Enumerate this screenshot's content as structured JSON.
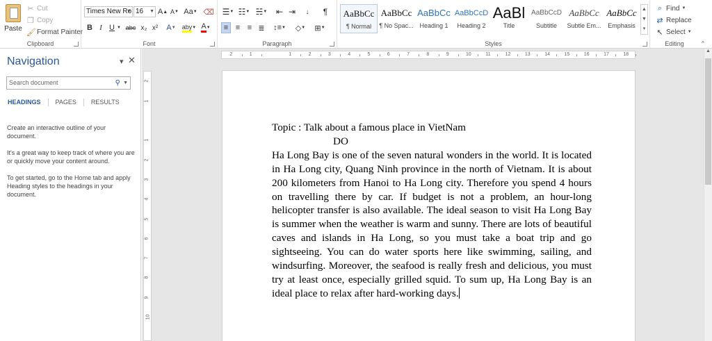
{
  "ribbon": {
    "clipboard": {
      "label": "Clipboard",
      "paste": "Paste",
      "cut": "Cut",
      "copy": "Copy",
      "format_painter": "Format Painter"
    },
    "font": {
      "label": "Font",
      "font_name": "Times New Ro",
      "font_size": "16",
      "grow": "A",
      "shrink": "A",
      "case": "Aa",
      "bold": "B",
      "italic": "I",
      "underline": "U",
      "strike": "abc",
      "subscript": "x₂",
      "superscript": "x²",
      "effects": "A",
      "highlight": "aby",
      "color": "A"
    },
    "paragraph": {
      "label": "Paragraph",
      "pilcrow": "¶"
    },
    "styles": {
      "label": "Styles",
      "items": [
        {
          "preview": "AaBbCc",
          "name": "¶ Normal"
        },
        {
          "preview": "AaBbCc",
          "name": "¶ No Spac..."
        },
        {
          "preview": "AaBbCc",
          "name": "Heading 1"
        },
        {
          "preview": "AaBbCcD",
          "name": "Heading 2"
        },
        {
          "preview": "AaBl",
          "name": "Title"
        },
        {
          "preview": "AaBbCcD",
          "name": "Subtitle"
        },
        {
          "preview": "AaBbCc",
          "name": "Subtle Em..."
        },
        {
          "preview": "AaBbCc",
          "name": "Emphasis"
        }
      ]
    },
    "editing": {
      "label": "Editing",
      "find": "Find",
      "replace": "Replace",
      "select": "Select"
    }
  },
  "navigation": {
    "title": "Navigation",
    "search_placeholder": "Search document",
    "tabs": [
      "HEADINGS",
      "PAGES",
      "RESULTS"
    ],
    "help": [
      "Create an interactive outline of your document.",
      "It's a great way to keep track of where you are or quickly move your content around.",
      "To get started, go to the Home tab and apply Heading styles to the headings in your document."
    ]
  },
  "ruler": {
    "h_ticks": [
      "2",
      "1",
      "1",
      "2",
      "3",
      "4",
      "5",
      "6",
      "7",
      "8",
      "9",
      "10",
      "11",
      "12",
      "13",
      "14",
      "15",
      "16",
      "17",
      "18"
    ],
    "v_ticks": [
      "2",
      "1",
      "1",
      "2",
      "3",
      "4",
      "5",
      "6",
      "7",
      "8",
      "9",
      "10",
      "11"
    ]
  },
  "document": {
    "topic_line": "Topic : Talk about a famous place in VietNam",
    "author_line": "DO",
    "body": "Ha Long Bay is one of the seven natural wonders in the world. It is located in Ha Long city, Quang Ninh province in the north of Vietnam. It is about 200 kilometers from Hanoi to Ha Long city. Therefore you spend 4 hours on travelling there by car. If budget is not a problem, an hour-long helicopter transfer is also available. The ideal season to visit Ha Long Bay is summer when the weather is warm and sunny. There are lots of beautiful caves and islands in Ha Long, so you must take a boat trip and go sightseeing. You can do water sports here like swimming, sailing, and windsurfing. Moreover, the seafood is really fresh and delicious, you must try at least once, especially grilled squid. To sum up, Ha Long Bay is an ideal place to relax after hard-working days."
  },
  "colors": {
    "accent": "#2b579a",
    "highlight_yellow": "#ffff00",
    "font_red": "#ff0000"
  }
}
